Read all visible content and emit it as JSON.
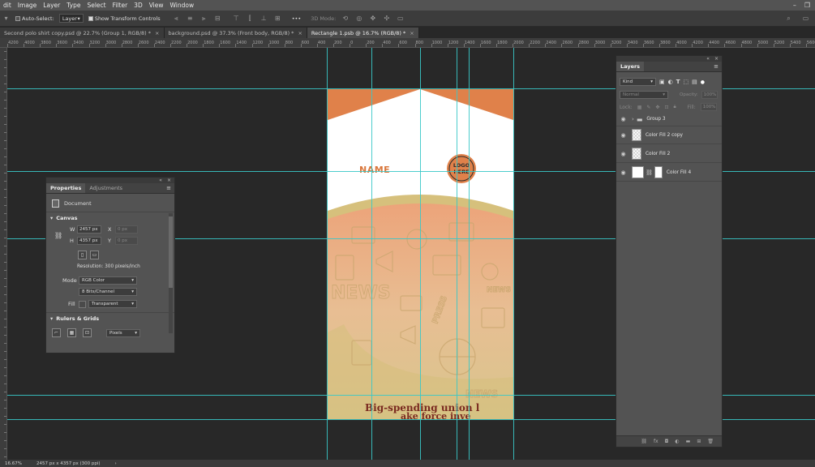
{
  "menu": [
    "dit",
    "Image",
    "Layer",
    "Type",
    "Select",
    "Filter",
    "3D",
    "View",
    "Window"
  ],
  "window_controls": [
    "–",
    "❐"
  ],
  "options": {
    "auto_select_label": "Auto-Select:",
    "auto_select_value": "Layer",
    "show_transform_label": "Show Transform Controls",
    "more_label": "•••",
    "mode_3d_label": "3D Mode:"
  },
  "tabs": [
    {
      "label": "Second polo shirt copy.psd @ 22.7% (Group 1, RGB/8) *",
      "active": false
    },
    {
      "label": "background.psd @ 37.3% (Front body, RGB/8) *",
      "active": false
    },
    {
      "label": "Rectangle 1.psb @ 16.7% (RGB/8) *",
      "active": true
    }
  ],
  "ruler_ticks": [
    "4200",
    "4000",
    "3800",
    "3600",
    "3400",
    "3200",
    "3000",
    "2800",
    "2600",
    "2400",
    "2200",
    "2000",
    "1800",
    "1600",
    "1400",
    "1200",
    "1000",
    "800",
    "600",
    "400",
    "200",
    "0",
    "200",
    "400",
    "600",
    "800",
    "1000",
    "1200",
    "1400",
    "1600",
    "1800",
    "2000",
    "2200",
    "2400",
    "2600",
    "2800",
    "3000",
    "3200",
    "3400",
    "3600",
    "3800",
    "4000",
    "4200",
    "4400",
    "4600",
    "4800",
    "5000",
    "5200",
    "5400",
    "5600",
    "5800",
    "6000"
  ],
  "document": {
    "name_text": "NAME",
    "logo_text": "LOGO HERE",
    "headline": "Big-spending union l",
    "headline2": "ake force inve",
    "news_words": [
      "NEWS",
      "NEWS",
      "PRESS",
      "NEWS"
    ],
    "colors": {
      "orange": "#e0814a",
      "tan": "#d6c07c",
      "peach": "#edb58f",
      "white": "#ffffff",
      "dark_logo": "#2c2c2c",
      "name_color": "#d9763b"
    }
  },
  "status": {
    "zoom": "16.67%",
    "doc_size": "2457 px x 4357 px (300 ppi)",
    "arrow": "›"
  },
  "properties": {
    "tabs": [
      "Properties",
      "Adjustments"
    ],
    "doc_label": "Document",
    "canvas_title": "Canvas",
    "w_label": "W",
    "w_value": "2457 px",
    "h_label": "H",
    "h_value": "4357 px",
    "x_label": "X",
    "x_value": "0 px",
    "y_label": "Y",
    "y_value": "0 px",
    "resolution": "Resolution: 300 pixels/inch",
    "mode_label": "Mode",
    "mode_value": "RGB Color",
    "bits_value": "8 Bits/Channel",
    "fill_label": "Fill",
    "fill_value": "Transparent",
    "rulers_title": "Rulers & Grids",
    "units_value": "Pixels"
  },
  "layers": {
    "title": "Layers",
    "filter_value": "Kind",
    "blend_value": "Normal",
    "opacity_label": "Opacity:",
    "opacity_value": "100%",
    "lock_label": "Lock:",
    "fill_label": "Fill:",
    "fill_value": "100%",
    "items": [
      {
        "name": "Group 3"
      },
      {
        "name": "Color Fill 2 copy"
      },
      {
        "name": "Color Fill 2"
      },
      {
        "name": "Color Fill 4"
      }
    ],
    "bottom_icons": [
      "link-icon",
      "fx-icon",
      "mask-icon",
      "adjustment-icon",
      "folder-icon",
      "new-layer-icon",
      "trash-icon"
    ]
  }
}
